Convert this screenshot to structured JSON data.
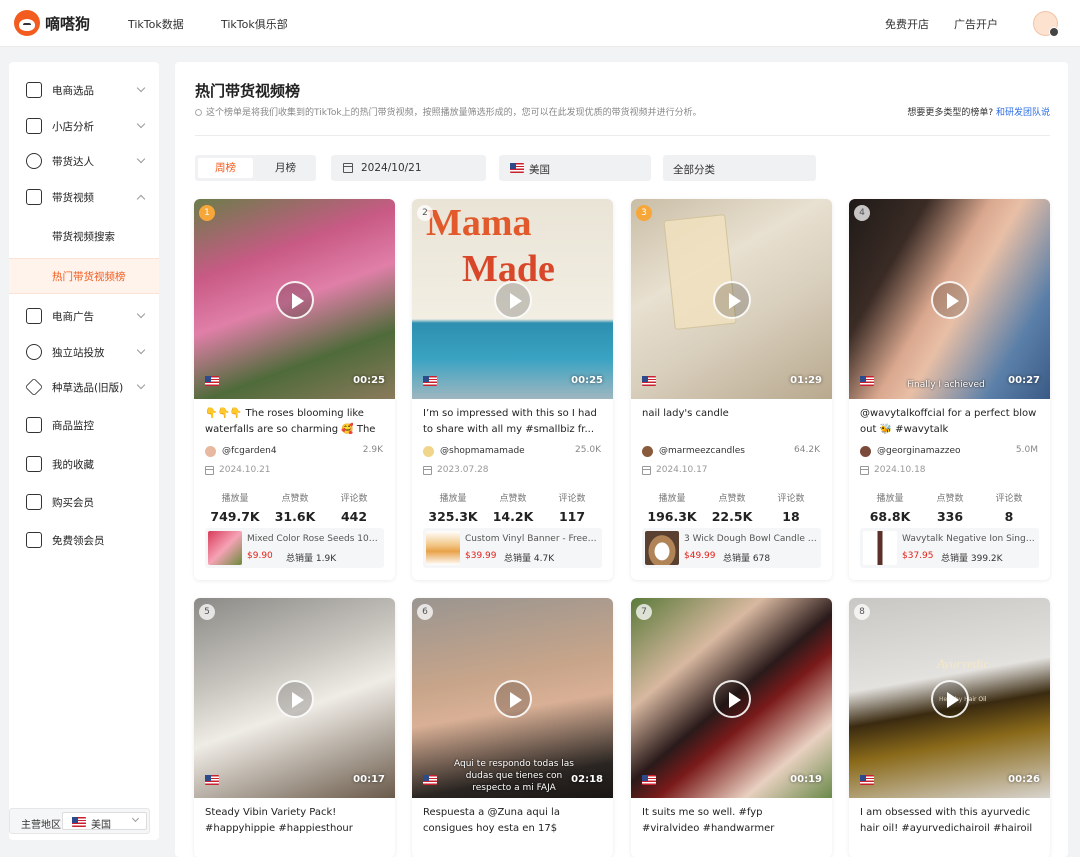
{
  "app": {
    "name": "嘀嗒狗"
  },
  "topnav": {
    "links": [
      "TikTok数据",
      "TikTok俱乐部"
    ],
    "right_links": [
      "免费开店",
      "广告开户"
    ]
  },
  "sidebar": {
    "items": [
      {
        "label": "电商选品",
        "icon": "cart-icon",
        "chevron": "down"
      },
      {
        "label": "小店分析",
        "icon": "store-icon",
        "chevron": "down"
      },
      {
        "label": "带货达人",
        "icon": "person-icon",
        "chevron": "down"
      },
      {
        "label": "带货视频",
        "icon": "video-camera-icon",
        "chevron": "up"
      },
      {
        "label": "电商广告",
        "icon": "ad-icon",
        "chevron": "down"
      },
      {
        "label": "独立站投放",
        "icon": "globe-pin-icon",
        "chevron": "down"
      },
      {
        "label": "种草选品(旧版)",
        "icon": "tag-icon",
        "chevron": "down"
      },
      {
        "label": "商品监控",
        "icon": "monitor-chart-icon",
        "chevron": ""
      },
      {
        "label": "我的收藏",
        "icon": "folder-star-icon",
        "chevron": ""
      },
      {
        "label": "购买会员",
        "icon": "vip-icon",
        "chevron": ""
      },
      {
        "label": "免费领会员",
        "icon": "free-gift-icon",
        "chevron": ""
      }
    ],
    "sub_items": [
      {
        "label": "带货视频搜索",
        "active": false
      },
      {
        "label": "热门带货视频榜",
        "active": true
      }
    ],
    "region": {
      "label": "主营地区",
      "value": "美国"
    }
  },
  "main": {
    "title": "热门带货视频榜",
    "subtitle": "这个榜单是将我们收集到的TikTok上的热门带货视频，按照播放量筛选形成的，您可以在此发现优质的带货视频并进行分析。",
    "contact_prompt": "想要更多类型的榜单?",
    "contact_link": "和研发团队说",
    "tabs": [
      "周榜",
      "月榜"
    ],
    "active_tab": "周榜",
    "date": "2024/10/21",
    "country": "美国",
    "category": "全部分类",
    "stat_labels": {
      "plays": "播放量",
      "likes": "点赞数",
      "comments": "评论数"
    },
    "sales_label": "总销量"
  },
  "videos": [
    {
      "rank": "1",
      "duration": "00:25",
      "caption": "👇👇👇 The roses blooming like waterfalls are so charming 🥰 The dis...",
      "author": "@fcgarden4",
      "followers": "2.9K",
      "date": "2024.10.21",
      "plays": "749.7K",
      "likes": "31.6K",
      "comments": "442",
      "product": "Mixed Color Rose Seeds 1000...",
      "price": "$9.90",
      "sales": "1.9K"
    },
    {
      "rank": "2",
      "duration": "00:25",
      "caption": "I’m so impressed with this so I had to share with all my #smallbiz fr...",
      "author": "@shopmamamade",
      "followers": "25.0K",
      "date": "2023.07.28",
      "plays": "325.3K",
      "likes": "14.2K",
      "comments": "117",
      "product": "Custom Vinyl Banner - Free O...",
      "price": "$39.99",
      "sales": "4.7K"
    },
    {
      "rank": "3",
      "duration": "01:29",
      "caption": "nail lady's candle",
      "author": "@marmeezcandles",
      "followers": "64.2K",
      "date": "2024.10.17",
      "plays": "196.3K",
      "likes": "22.5K",
      "comments": "18",
      "product": "3 Wick Dough Bowl Candle -...",
      "price": "$49.99",
      "sales": "678"
    },
    {
      "rank": "4",
      "duration": "00:27",
      "caption": "@wavytalkoffcial for a perfect blow out 🐝 #wavytalk #thermalbrush#...",
      "author": "@georginamazzeo",
      "followers": "5.0M",
      "date": "2024.10.18",
      "plays": "68.8K",
      "likes": "336",
      "comments": "8",
      "product": "Wavytalk Negative Ion Single...",
      "price": "$37.95",
      "sales": "399.2K"
    },
    {
      "rank": "5",
      "duration": "00:17",
      "caption": "Steady Vibin Variety Pack! #happyhippie #happiesthour #steadyvibin"
    },
    {
      "rank": "6",
      "duration": "02:18",
      "caption": "Respuesta a @Zuna aqui la consigues hoy esta en 17$ solamente cali..."
    },
    {
      "rank": "7",
      "duration": "00:19",
      "caption": "It suits me so well. #fyp #viralvideo #handwarmer #keepwarm #powe..."
    },
    {
      "rank": "8",
      "duration": "00:26",
      "caption": "I am obsessed with this ayurvedic hair oil! #ayurvedichairoil #hairoil ..."
    }
  ],
  "thumb_text": {
    "banner_top": "Mama",
    "banner_bottom": "Made",
    "overlay_4": "Finally I achieved",
    "overlay_6a": "Aqui te respondo todas las",
    "overlay_6b": "dudas que tienes con",
    "overlay_6c": "respecto a mi FAJA",
    "oil_label": "Ayurvedic",
    "oil_sub": "Healthy Hair Oil"
  },
  "colors": {
    "accent": "#f25c1e",
    "price": "#e2231a",
    "link": "#2b6de5"
  }
}
